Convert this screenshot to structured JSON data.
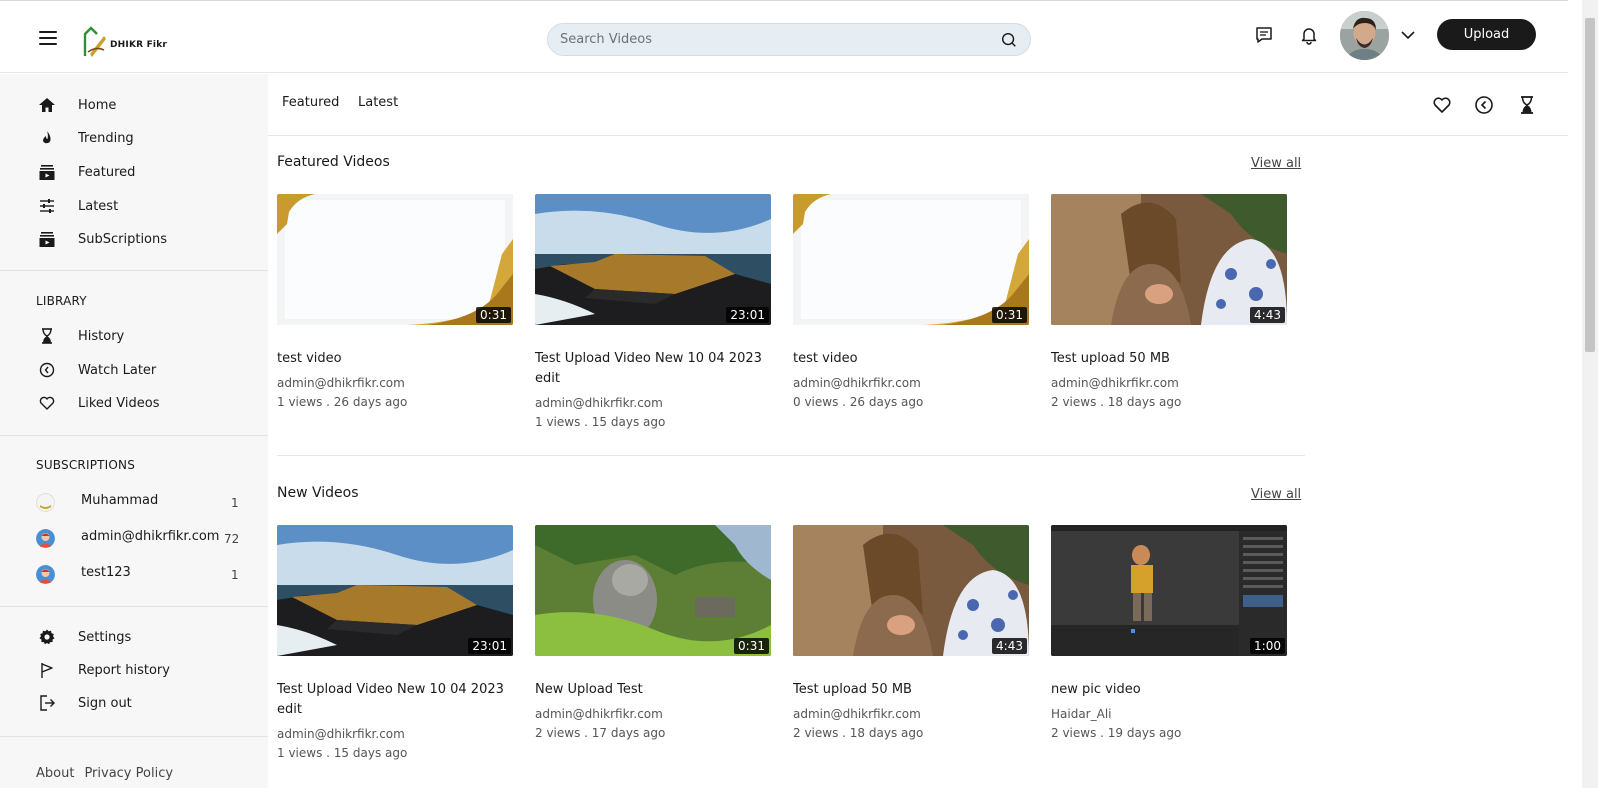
{
  "header": {
    "logo_text": "DHIKR Fikr",
    "search_placeholder": "Search Videos",
    "upload_label": "Upload"
  },
  "sidebar": {
    "main_items": [
      {
        "label": "Home",
        "icon": "home-icon"
      },
      {
        "label": "Trending",
        "icon": "flame-icon"
      },
      {
        "label": "Featured",
        "icon": "featured-icon"
      },
      {
        "label": "Latest",
        "icon": "sliders-icon"
      },
      {
        "label": "SubScriptions",
        "icon": "subscriptions-icon"
      }
    ],
    "library_heading": "LIBRARY",
    "library_items": [
      {
        "label": "History",
        "icon": "hourglass-icon"
      },
      {
        "label": "Watch Later",
        "icon": "clock-back-icon"
      },
      {
        "label": "Liked Videos",
        "icon": "heart-icon"
      }
    ],
    "subscriptions_heading": "SUBSCRIPTIONS",
    "subscriptions": [
      {
        "name": "Muhammad",
        "count": "1"
      },
      {
        "name": "admin@dhikrfikr.com",
        "count": "72"
      },
      {
        "name": "test123",
        "count": "1"
      }
    ],
    "bottom_items": [
      {
        "label": "Settings",
        "icon": "gear-icon"
      },
      {
        "label": "Report history",
        "icon": "flag-icon"
      },
      {
        "label": "Sign out",
        "icon": "sign-out-icon"
      }
    ],
    "footer": {
      "about": "About",
      "privacy": "Privacy Policy"
    }
  },
  "tabs": {
    "featured": "Featured",
    "latest": "Latest"
  },
  "sections": {
    "featured": {
      "title": "Featured Videos",
      "view_all": "View all",
      "videos": [
        {
          "title": "test video",
          "author": "admin@dhikrfikr.com",
          "views": "1 views",
          "age": "26 days ago",
          "duration": "0:31",
          "thumb": "gold-frame"
        },
        {
          "title": "Test Upload Video New 10 04 2023 edit",
          "author": "admin@dhikrfikr.com",
          "views": "1 views",
          "age": "15 days ago",
          "duration": "23:01",
          "thumb": "coast"
        },
        {
          "title": "test video",
          "author": "admin@dhikrfikr.com",
          "views": "0 views",
          "age": "26 days ago",
          "duration": "0:31",
          "thumb": "gold-frame"
        },
        {
          "title": "Test upload 50 MB",
          "author": "admin@dhikrfikr.com",
          "views": "2 views",
          "age": "18 days ago",
          "duration": "4:43",
          "thumb": "scene"
        }
      ]
    },
    "new": {
      "title": "New Videos",
      "view_all": "View all",
      "videos": [
        {
          "title": "Test Upload Video New 10 04 2023 edit",
          "author": "admin@dhikrfikr.com",
          "views": "1 views",
          "age": "15 days ago",
          "duration": "23:01",
          "thumb": "coast"
        },
        {
          "title": "New Upload Test",
          "author": "admin@dhikrfikr.com",
          "views": "2 views",
          "age": "17 days ago",
          "duration": "0:31",
          "thumb": "forest"
        },
        {
          "title": "Test upload 50 MB",
          "author": "admin@dhikrfikr.com",
          "views": "2 views",
          "age": "18 days ago",
          "duration": "4:43",
          "thumb": "scene"
        },
        {
          "title": "new pic video",
          "author": "Haidar_Ali",
          "views": "2 views",
          "age": "19 days ago",
          "duration": "1:00",
          "thumb": "editor"
        }
      ]
    }
  },
  "colors": {
    "accent": "#1a1a1a",
    "sidebar_bg": "#f7f7f7",
    "search_bg": "#e6eef3",
    "logo_green": "#2f8f3a"
  }
}
